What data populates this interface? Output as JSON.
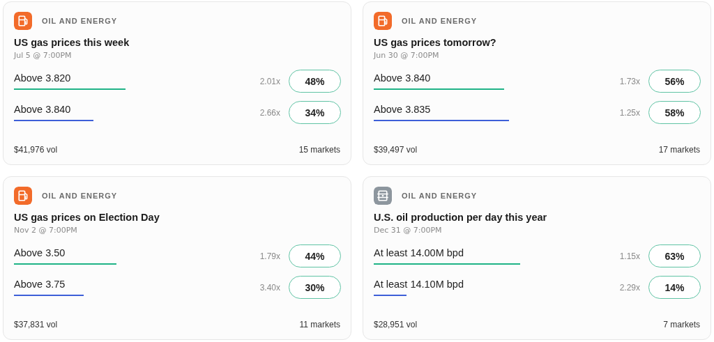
{
  "cards": [
    {
      "kind": "fuel",
      "category": "OIL AND ENERGY",
      "title": "US gas prices this week",
      "date": "Jul 5 @ 7:00PM",
      "outcomes": [
        {
          "label": "Above 3.820",
          "color": "#1fb386",
          "multiplier": "2.01x",
          "percent": "48%"
        },
        {
          "label": "Above 3.840",
          "color": "#3d5fd8",
          "multiplier": "2.66x",
          "percent": "34%"
        }
      ],
      "volume": "$41,976 vol",
      "markets": "15 markets"
    },
    {
      "kind": "fuel",
      "category": "OIL AND ENERGY",
      "title": "US gas prices tomorrow?",
      "date": "Jun 30 @ 7:00PM",
      "outcomes": [
        {
          "label": "Above 3.840",
          "color": "#1fb386",
          "multiplier": "1.73x",
          "percent": "56%"
        },
        {
          "label": "Above 3.835",
          "color": "#3d5fd8",
          "multiplier": "1.25x",
          "percent": "58%"
        }
      ],
      "volume": "$39,497 vol",
      "markets": "17 markets"
    },
    {
      "kind": "fuel",
      "category": "OIL AND ENERGY",
      "title": "US gas prices on Election Day",
      "date": "Nov 2 @ 7:00PM",
      "outcomes": [
        {
          "label": "Above 3.50",
          "color": "#1fb386",
          "multiplier": "1.79x",
          "percent": "44%"
        },
        {
          "label": "Above 3.75",
          "color": "#3d5fd8",
          "multiplier": "3.40x",
          "percent": "30%"
        }
      ],
      "volume": "$37,831 vol",
      "markets": "11 markets"
    },
    {
      "kind": "barrel",
      "category": "OIL AND ENERGY",
      "title": "U.S. oil production per day this year",
      "date": "Dec 31 @ 7:00PM",
      "outcomes": [
        {
          "label": "At least 14.00M bpd",
          "color": "#1fb386",
          "multiplier": "1.15x",
          "percent": "63%"
        },
        {
          "label": "At least 14.10M bpd",
          "color": "#3d5fd8",
          "multiplier": "2.29x",
          "percent": "14%"
        }
      ],
      "volume": "$28,951 vol",
      "markets": "7 markets"
    }
  ]
}
